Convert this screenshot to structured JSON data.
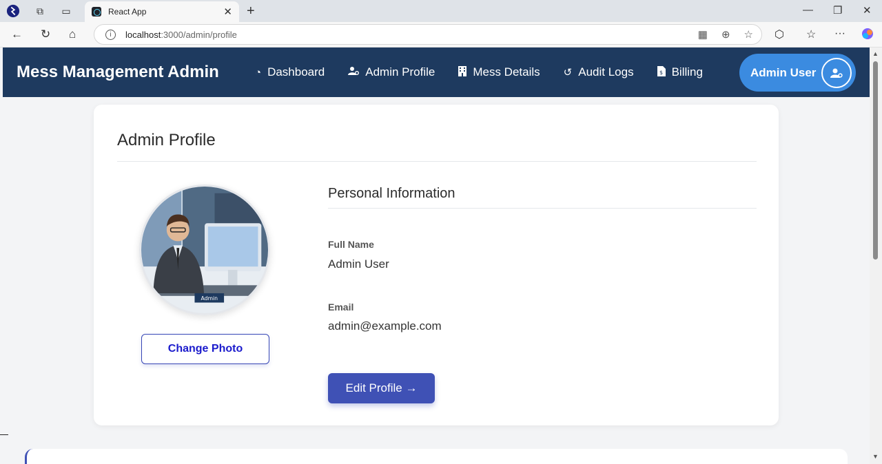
{
  "browser": {
    "tab_title": "React App",
    "url_host": "localhost",
    "url_rest": ":3000/admin/profile"
  },
  "app": {
    "brand": "Mess Management Admin",
    "nav": [
      {
        "label": "Dashboard",
        "icon": "dashboard-gauge-icon"
      },
      {
        "label": "Admin Profile",
        "icon": "user-cog-icon"
      },
      {
        "label": "Mess Details",
        "icon": "building-icon"
      },
      {
        "label": "Audit Logs",
        "icon": "history-icon"
      },
      {
        "label": "Billing",
        "icon": "invoice-icon"
      }
    ],
    "user_name": "Admin User"
  },
  "profile": {
    "title": "Admin Profile",
    "photo_caption": "Admin",
    "change_photo_label": "Change Photo",
    "section_title": "Personal Information",
    "full_name_label": "Full Name",
    "full_name_value": "Admin User",
    "email_label": "Email",
    "email_value": "admin@example.com",
    "edit_label": "Edit Profile →"
  },
  "colors": {
    "navbar": "#1e3a5f",
    "user_pill": "#3b8be0",
    "primary_button": "#3f51b5"
  }
}
